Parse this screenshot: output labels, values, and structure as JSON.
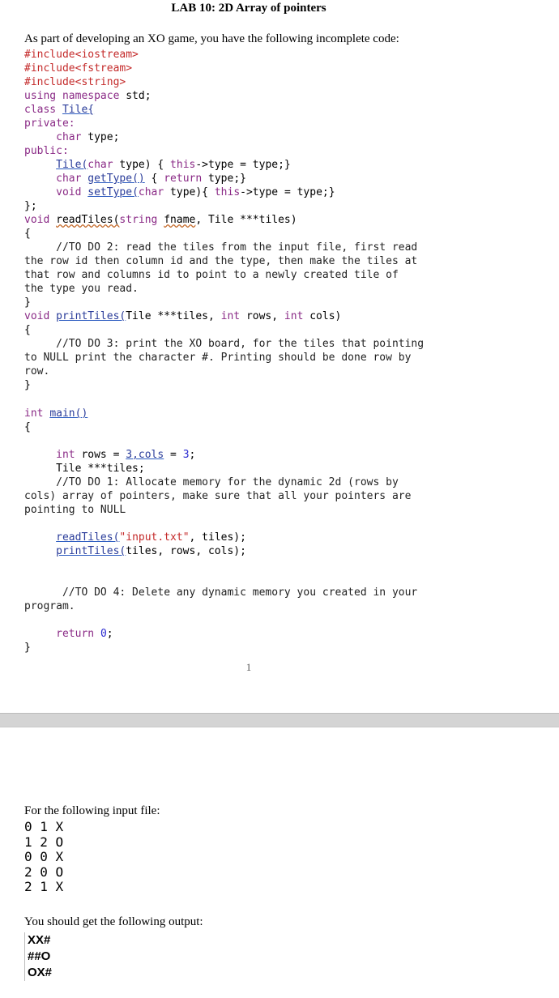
{
  "title": "LAB 10: 2D Array of pointers",
  "intro": "As part of developing an XO game, you have the following incomplete code:",
  "code": {
    "l1": "#include<iostream>",
    "l2": "#include<fstream>",
    "l3": "#include<string>",
    "l4a": "using namespace",
    "l4b": " std;",
    "l5a": "class",
    "l5b": "Tile{",
    "l6": "private:",
    "l7a": "char",
    "l7b": " type;",
    "l8": "public:",
    "l9a": "Tile(",
    "l9b": "char",
    "l9c": " type) { ",
    "l9d": "this",
    "l9e": "->type = type;}",
    "l10a": "char",
    "l10b": "getType()",
    "l10c": " { ",
    "l10d": "return",
    "l10e": " type;}",
    "l11a": "void",
    "l11b": "setType(",
    "l11c": "char",
    "l11d": " type){ ",
    "l11e": "this",
    "l11f": "->type = type;}",
    "l12": "};",
    "l13a": "void",
    "l13b": "readTiles(",
    "l13c": "string",
    "l13d": "fname",
    "l13e": ", Tile ***tiles)",
    "l14": "{",
    "l15": "//TO DO 2: read the tiles from the input file, first read",
    "l16": "the row id then column id and the type, then make the tiles at",
    "l17": "that row and columns id to point to a newly created tile of",
    "l18": "the type you read.",
    "l19": "}",
    "l20a": "void",
    "l20b": "printTiles(",
    "l20c": "Tile ***tiles, ",
    "l20d": "int",
    "l20e": " rows, ",
    "l20f": "int",
    "l20g": " cols)",
    "l21": "{",
    "l22": "//TO DO 3: print the XO board, for the tiles that pointing",
    "l23": "to NULL print the character #. Printing should be done row by",
    "l24": "row.",
    "l25": "}",
    "l26a": "int",
    "l26b": "main()",
    "l27": "{",
    "l28a": "int",
    "l28b": " rows = ",
    "l28c": "3,cols",
    "l28d": " = ",
    "l28e": "3",
    "l28f": ";",
    "l29": "Tile ***tiles;",
    "l30": "//TO DO 1: Allocate memory for the dynamic 2d (rows by",
    "l31": "cols) array of pointers, make sure that all your pointers are",
    "l32": "pointing to NULL",
    "l33a": "readTiles(",
    "l33b": "\"input.txt\"",
    "l33c": ", tiles);",
    "l34a": "printTiles(",
    "l34b": "tiles, rows, cols);",
    "l35": "//TO DO 4: Delete any dynamic memory you created in your",
    "l36": "program.",
    "l37a": "return",
    "l37b": "0",
    "l37c": ";",
    "l38": "}"
  },
  "page_number": "1",
  "page2": {
    "input_label": "For the following input file:",
    "input_lines": [
      "0 1 X",
      "1 2 O",
      "0 0 X",
      "2 0 O",
      "2 1 X"
    ],
    "output_label": "You should get the following output:",
    "output_lines": [
      "XX#",
      "##O",
      "OX#"
    ]
  }
}
